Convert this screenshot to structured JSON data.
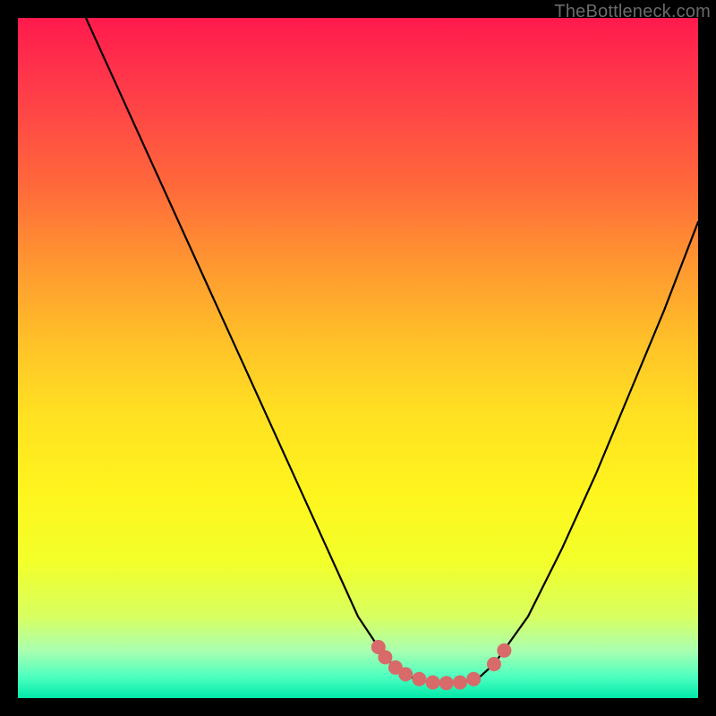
{
  "watermark": {
    "text": "TheBottleneck.com"
  },
  "colors": {
    "background": "#000000",
    "curve_stroke": "#000000",
    "marker_fill": "#d86a6a",
    "marker_stroke": "#c04f4f"
  },
  "chart_data": {
    "type": "line",
    "title": "",
    "xlabel": "",
    "ylabel": "",
    "xlim": [
      0,
      100
    ],
    "ylim": [
      0,
      100
    ],
    "series": [
      {
        "name": "curve",
        "x": [
          10,
          15,
          20,
          25,
          30,
          35,
          40,
          45,
          50,
          52,
          54,
          56,
          58,
          60,
          62,
          64,
          66,
          68,
          70,
          75,
          80,
          85,
          90,
          95,
          100
        ],
        "y": [
          100,
          89,
          78,
          67,
          56,
          45,
          34,
          23,
          12,
          9,
          6,
          4,
          3,
          2.5,
          2.2,
          2.2,
          2.5,
          3.2,
          5,
          12,
          22,
          33,
          45,
          57,
          70
        ]
      }
    ],
    "markers": [
      {
        "x": 53,
        "y": 7.5
      },
      {
        "x": 54,
        "y": 6
      },
      {
        "x": 55.5,
        "y": 4.5
      },
      {
        "x": 57,
        "y": 3.5
      },
      {
        "x": 59,
        "y": 2.8
      },
      {
        "x": 61,
        "y": 2.3
      },
      {
        "x": 63,
        "y": 2.2
      },
      {
        "x": 65,
        "y": 2.3
      },
      {
        "x": 67,
        "y": 2.8
      },
      {
        "x": 70,
        "y": 5
      },
      {
        "x": 71.5,
        "y": 7
      }
    ]
  }
}
